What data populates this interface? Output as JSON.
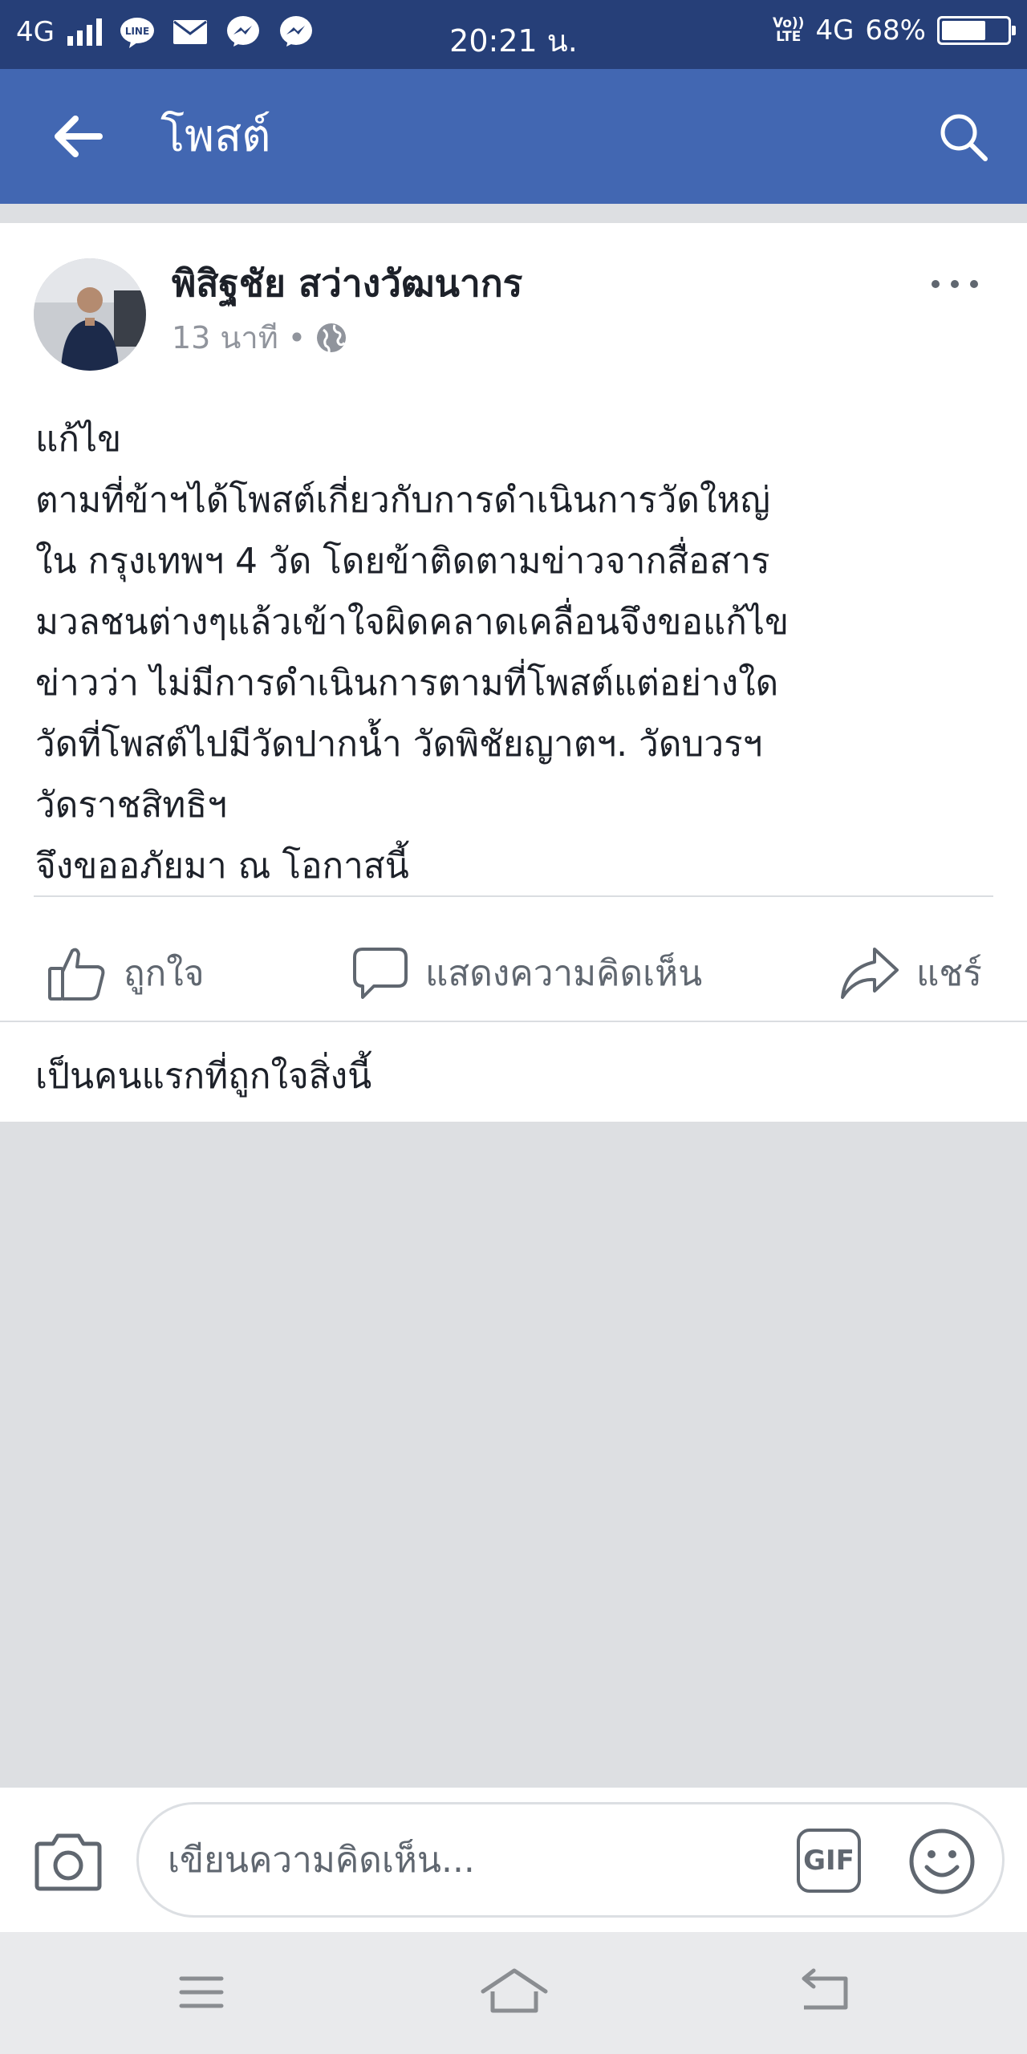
{
  "status_bar": {
    "network": "4G",
    "time": "20:21 น.",
    "volte_top": "Vo))",
    "volte_bottom": "LTE",
    "data_network": "4G",
    "battery": "68%",
    "battery_level": 0.68
  },
  "app_bar": {
    "title": "โพสต์"
  },
  "post": {
    "author": "พิสิฐชัย สว่างวัฒนากร",
    "time": "13 นาที",
    "separator": "•",
    "body_lines": [
      "แก้ไข",
      "ตามที่ข้าฯได้โพสต์เกี่ยวกับการดำเนินการวัดใหญ่",
      "ใน กรุงเทพฯ 4 วัด  โดยข้าติดตามข่าวจากสื่อสาร",
      "มวลชนต่างๆแล้วเข้าใจผิดคลาดเคลื่อนจึงขอแก้ไข",
      "ข่าวว่า ไม่มีการดำเนินการตามที่โพสต์แต่อย่างใด",
      "วัดที่โพสต์ไปมีวัดปากน้ำ วัดพิชัยญาตฯ. วัดบวรฯ",
      "วัดราชสิทธิฯ",
      "จึงขออภัยมา ณ โอกาสนี้"
    ],
    "actions": {
      "like": "ถูกใจ",
      "comment": "แสดงความคิดเห็น",
      "share": "แชร์"
    },
    "first_like": "เป็นคนแรกที่ถูกใจสิ่งนี้"
  },
  "composer": {
    "placeholder": "เขียนความคิดเห็น...",
    "gif": "GIF"
  },
  "colors": {
    "status_bar": "#263f78",
    "app_bar": "#4267b2",
    "background": "#dddfe2"
  }
}
